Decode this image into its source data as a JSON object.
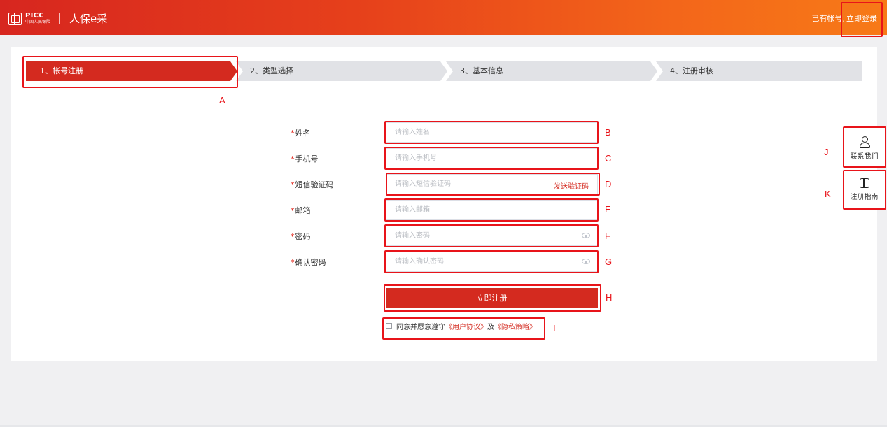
{
  "header": {
    "logo_en": "PICC",
    "logo_cn": "中国人民保险",
    "app_name": "人保e采",
    "has_account_text": "已有帐号,",
    "login_link": "立即登录"
  },
  "steps": [
    {
      "label": "1、帐号注册",
      "active": true
    },
    {
      "label": "2、类型选择",
      "active": false
    },
    {
      "label": "3、基本信息",
      "active": false
    },
    {
      "label": "4、注册审核",
      "active": false
    }
  ],
  "form": {
    "required_mark": "*",
    "name": {
      "label": "姓名",
      "placeholder": "请输入姓名",
      "value": ""
    },
    "phone": {
      "label": "手机号",
      "placeholder": "请输入手机号",
      "value": ""
    },
    "sms": {
      "label": "短信验证码",
      "placeholder": "请输入短信验证码",
      "value": "",
      "send_label": "发送验证码"
    },
    "email": {
      "label": "邮箱",
      "placeholder": "请输入邮箱",
      "value": ""
    },
    "password": {
      "label": "密码",
      "placeholder": "请输入密码",
      "value": ""
    },
    "confirm_password": {
      "label": "确认密码",
      "placeholder": "请输入确认密码",
      "value": ""
    },
    "submit_label": "立即注册",
    "agree": {
      "checked": false,
      "prefix": "同意并愿意遵守",
      "user_agreement": "《用户协议》",
      "conjunction": "及",
      "privacy_policy": "《隐私策略》"
    }
  },
  "side": {
    "contact_label": "联系我们",
    "guide_label": "注册指南"
  },
  "annotations": {
    "A": "A",
    "B": "B",
    "C": "C",
    "D": "D",
    "E": "E",
    "F": "F",
    "G": "G",
    "H": "H",
    "I": "I",
    "J": "J",
    "K": "K"
  },
  "colors": {
    "brand_red": "#d42a1f",
    "header_gradient_start": "#d7261f",
    "header_gradient_end": "#f77a17",
    "annotation_red": "#e8141a"
  }
}
